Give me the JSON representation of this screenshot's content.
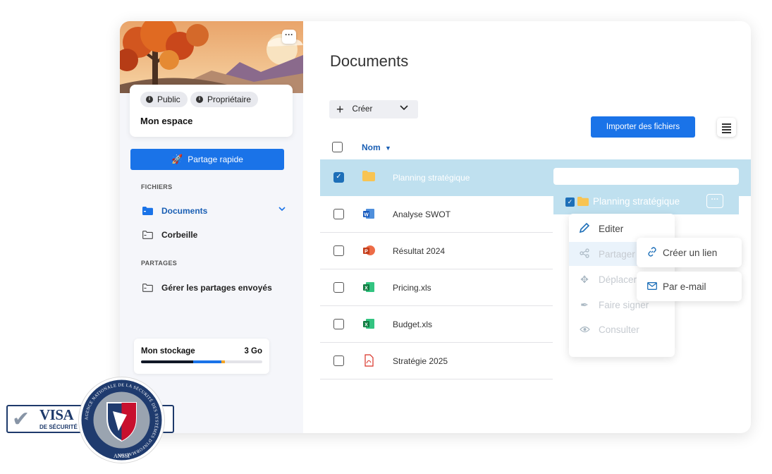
{
  "sidebar": {
    "chips": [
      "Public",
      "Propriétaire"
    ],
    "space_title": "Mon espace",
    "quick_share": "Partage rapide",
    "section_files": "FICHIERS",
    "nav_documents": "Documents",
    "nav_trash": "Corbeille",
    "section_shares": "PARTAGES",
    "nav_shares": "Gérer les partages envoyés",
    "storage_label": "Mon stockage",
    "storage_value": "3 Go",
    "storage_segments": [
      {
        "fraction": 0.43,
        "color": "#111827"
      },
      {
        "fraction": 0.23,
        "color": "#1a73e8"
      },
      {
        "fraction": 0.03,
        "color": "#f5a524"
      }
    ]
  },
  "main": {
    "title": "Documents",
    "create_label": "Créer",
    "import_label": "Importer des fichiers",
    "col_name": "Nom",
    "files": [
      {
        "name": "Planning stratégique",
        "icon": "folder-icon",
        "selected": true
      },
      {
        "name": "Analyse SWOT",
        "icon": "word-icon",
        "selected": false
      },
      {
        "name": "Résultat 2024",
        "icon": "powerpoint-icon",
        "selected": false
      },
      {
        "name": "Pricing.xls",
        "icon": "excel-icon",
        "selected": false
      },
      {
        "name": "Budget.xls",
        "icon": "excel-icon",
        "selected": false
      },
      {
        "name": "Stratégie 2025",
        "icon": "pdf-icon",
        "selected": false
      }
    ]
  },
  "detail": {
    "name": "Planning stratégique",
    "more": "···"
  },
  "context_menu": {
    "items": [
      "Editer",
      "Partager",
      "Déplacer",
      "Faire signer",
      "Consulter"
    ],
    "submenu": [
      "Créer un lien",
      "Par e-mail"
    ]
  },
  "badges": {
    "visa_title": "VISA",
    "visa_sub": "DE SÉCURITÉ",
    "seal_text": "AGENCE NATIONALE DE LA SÉCURITÉ DES SYSTÈMES D'INFORMATION",
    "seal_abbr": "ANSSI"
  },
  "colors": {
    "accent": "#1a73e8",
    "selection": "#bfe0ef",
    "sidebar_bg": "#f5f6fa",
    "link": "#1a5fb4"
  }
}
